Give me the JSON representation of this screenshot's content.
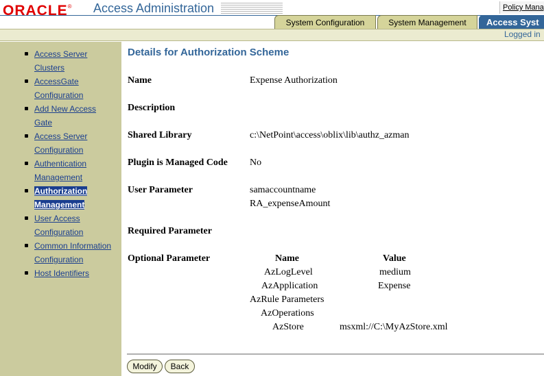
{
  "header": {
    "logo": "ORACLE",
    "logo_mark": "®",
    "app_title": "Access Administration",
    "policy_link": "Policy Manag",
    "tabs": [
      {
        "label": "System Configuration",
        "active": false
      },
      {
        "label": "System Management",
        "active": false
      },
      {
        "label": "Access Syst",
        "active": true
      }
    ],
    "logged_in": "Logged in"
  },
  "sidebar": {
    "items": [
      {
        "line1": "Access Server",
        "line2": "Clusters"
      },
      {
        "line1": "AccessGate",
        "line2": "Configuration"
      },
      {
        "line1": "Add New Access",
        "line2": "Gate"
      },
      {
        "line1": "Access Server",
        "line2": "Configuration"
      },
      {
        "line1": "Authentication",
        "line2": "Management"
      },
      {
        "line1": "Authorization",
        "line2": "Management",
        "active": true
      },
      {
        "line1": "User Access",
        "line2": "Configuration"
      },
      {
        "line1": "Common Information",
        "line2": "Configuration"
      },
      {
        "line1": "Host Identifiers",
        "line2": ""
      }
    ]
  },
  "details": {
    "title": "Details for Authorization Scheme",
    "name_label": "Name",
    "name_value": "Expense Authorization",
    "description_label": "Description",
    "description_value": "",
    "shared_library_label": "Shared Library",
    "shared_library_value": "c:\\NetPoint\\access\\oblix\\lib\\authz_azman",
    "plugin_label": "Plugin is Managed Code",
    "plugin_value": "No",
    "user_param_label": "User Parameter",
    "user_params": [
      "samaccountname",
      "RA_expenseAmount"
    ],
    "required_param_label": "Required Parameter",
    "optional_param_label": "Optional Parameter",
    "optional_head_name": "Name",
    "optional_head_value": "Value",
    "optional_params": [
      {
        "name": "AzLogLevel",
        "value": "medium"
      },
      {
        "name": "AzApplication",
        "value": "Expense"
      },
      {
        "name": "AzRule Parameters",
        "value": ""
      },
      {
        "name": "AzOperations",
        "value": ""
      },
      {
        "name": "AzStore",
        "value": "msxml://C:\\MyAzStore.xml"
      }
    ]
  },
  "buttons": {
    "modify": "Modify",
    "back": "Back"
  },
  "colors": {
    "brand_red": "#e00000",
    "accent_blue": "#336699",
    "sidebar_bg": "#cbcb9e",
    "tab_bg": "#d5d49a"
  }
}
